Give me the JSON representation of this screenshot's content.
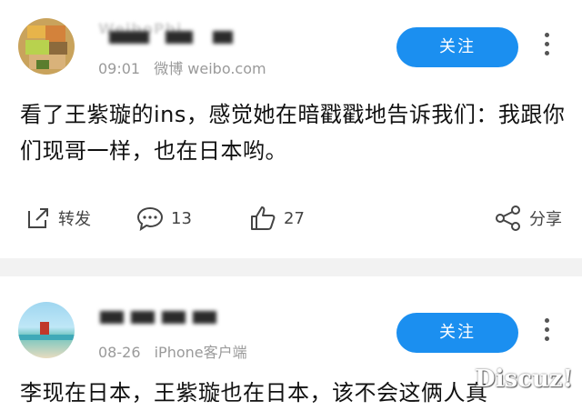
{
  "posts": [
    {
      "username_partial": "WeiboPhi",
      "time": "09:01",
      "source": "微博 weibo.com",
      "follow_label": "关注",
      "content": "看了王紫璇的ins，感觉她在暗戳戳地告诉我们：我跟你们现哥一样，也在日本哟。",
      "actions": {
        "repost_label": "转发",
        "comment_count": "13",
        "like_count": "27",
        "share_label": "分享"
      }
    },
    {
      "time": "08-26",
      "source": "iPhone客户端",
      "follow_label": "关注",
      "content": "李现在日本，王紫璇也在日本，该不会这俩人真"
    }
  ],
  "watermark": "Discuz!",
  "colors": {
    "accent": "#1b8ff0",
    "divider": "#f2f2f2",
    "text": "#111111",
    "meta": "#9a9a9a"
  },
  "icons": [
    "more-vertical-icon",
    "repost-icon",
    "comment-icon",
    "like-icon",
    "share-icon"
  ]
}
